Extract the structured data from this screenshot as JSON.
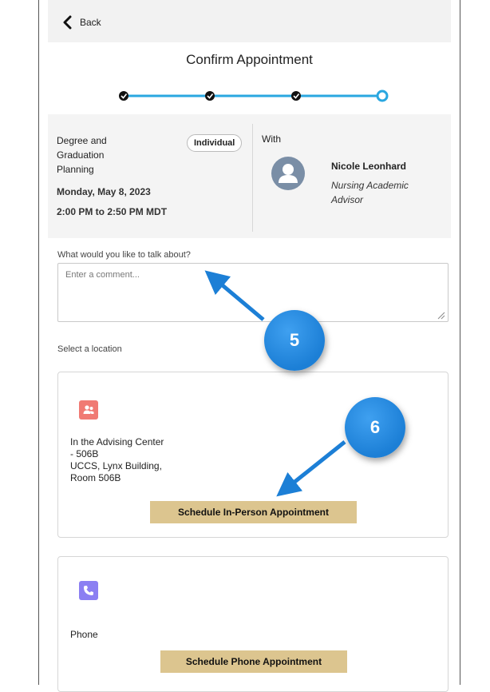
{
  "nav": {
    "back_label": "Back"
  },
  "header": {
    "title": "Confirm Appointment"
  },
  "progress": {
    "steps_total": 4,
    "steps_completed": 3
  },
  "appointment": {
    "name": "Degree and\nGraduation\nPlanning",
    "type_badge": "Individual",
    "date": "Monday, May 8, 2023",
    "time": "2:00 PM to 2:50 PM MDT",
    "with_label": "With",
    "advisor_name": "Nicole Leonhard",
    "advisor_title": "Nursing Academic Advisor"
  },
  "comment": {
    "label": "What would you like to talk about?",
    "placeholder": "Enter a comment...",
    "value": ""
  },
  "location": {
    "label": "Select a location",
    "options": [
      {
        "icon": "in-person-icon",
        "icon_color": "#f07a73",
        "text": "In the Advising Center\n- 506B\nUCCS, Lynx Building,\nRoom 506B",
        "button": "Schedule In-Person Appointment"
      },
      {
        "icon": "phone-icon",
        "icon_color": "#8b7ff2",
        "text": "Phone",
        "button": "Schedule Phone Appointment"
      }
    ]
  },
  "callouts": {
    "first": "5",
    "second": "6"
  },
  "colors": {
    "accent": "#2aa7e0",
    "button": "#dcc58f",
    "callout": "#1c7fd6"
  }
}
